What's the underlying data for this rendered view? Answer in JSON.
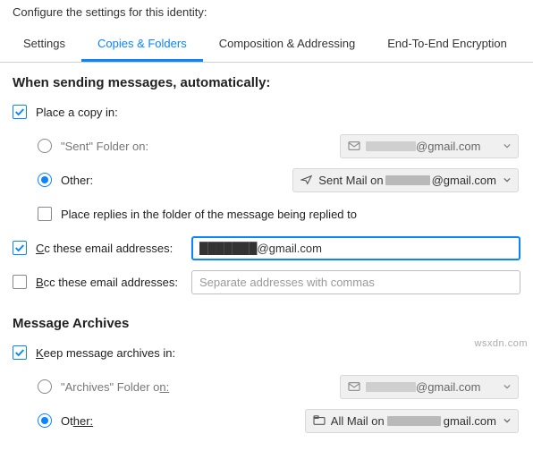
{
  "header": {
    "title": "Configure the settings for this identity:"
  },
  "tabs": {
    "settings": "Settings",
    "copies": "Copies & Folders",
    "composition": "Composition & Addressing",
    "encryption": "End-To-End Encryption"
  },
  "sending": {
    "title": "When sending messages, automatically:",
    "place_copy": "Place a copy in:",
    "sent_folder": "\"Sent\" Folder on:",
    "other": "Other:",
    "sent_account_suffix": "@gmail.com",
    "sent_mail_prefix": "Sent Mail on ",
    "sent_mail_suffix": "@gmail.com",
    "place_replies": "Place replies in the folder of the message being replied to",
    "cc_label_prefix": "C",
    "cc_label_suffix": "c these email addresses:",
    "cc_value": "███████@gmail.com",
    "bcc_label_prefix": "B",
    "bcc_label_suffix": "cc these email addresses:",
    "bcc_placeholder": "Separate addresses with commas"
  },
  "archives": {
    "title": "Message Archives",
    "keep_prefix": "K",
    "keep_suffix": "eep message archives in:",
    "archives_folder_prefix": "\"Archives\" Folder o",
    "archives_folder_suffix": "n:",
    "other_prefix": "Ot",
    "other_suffix": "her:",
    "archives_acct_suffix": "@gmail.com",
    "allmail_prefix": "All Mail on",
    "allmail_suffix": "gmail.com"
  },
  "watermark": "wsxdn.com"
}
